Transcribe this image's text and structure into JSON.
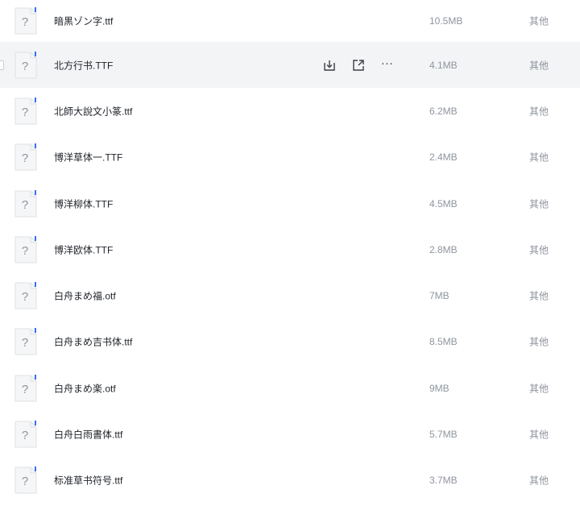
{
  "files": [
    {
      "name": "暗黒ゾン字.ttf",
      "size": "10.5MB",
      "type": "其他",
      "icon": "unknown-file-icon"
    },
    {
      "name": "北方行书.TTF",
      "size": "4.1MB",
      "type": "其他",
      "icon": "unknown-file-icon",
      "hovered": true
    },
    {
      "name": "北師大說文小篆.ttf",
      "size": "6.2MB",
      "type": "其他",
      "icon": "unknown-file-icon"
    },
    {
      "name": "博洋草体一.TTF",
      "size": "2.4MB",
      "type": "其他",
      "icon": "unknown-file-icon"
    },
    {
      "name": "博洋柳体.TTF",
      "size": "4.5MB",
      "type": "其他",
      "icon": "unknown-file-icon"
    },
    {
      "name": "博洋欧体.TTF",
      "size": "2.8MB",
      "type": "其他",
      "icon": "unknown-file-icon"
    },
    {
      "name": "白舟まめ福.otf",
      "size": "7MB",
      "type": "其他",
      "icon": "unknown-file-icon"
    },
    {
      "name": "白舟まめ吉书体.ttf",
      "size": "8.5MB",
      "type": "其他",
      "icon": "unknown-file-icon"
    },
    {
      "name": "白舟まめ楽.otf",
      "size": "9MB",
      "type": "其他",
      "icon": "unknown-file-icon"
    },
    {
      "name": "白舟白雨書体.ttf",
      "size": "5.7MB",
      "type": "其他",
      "icon": "unknown-file-icon"
    },
    {
      "name": "标准草书符号.ttf",
      "size": "3.7MB",
      "type": "其他",
      "icon": "unknown-file-icon"
    }
  ],
  "row_actions": {
    "download": "download-icon",
    "share": "share-icon",
    "more": "more-icon"
  },
  "colors": {
    "hover_row_bg": "#f3f4f6",
    "name_text": "#1f2329",
    "meta_text": "#8f959e",
    "icon_accent": "#3370ff"
  }
}
